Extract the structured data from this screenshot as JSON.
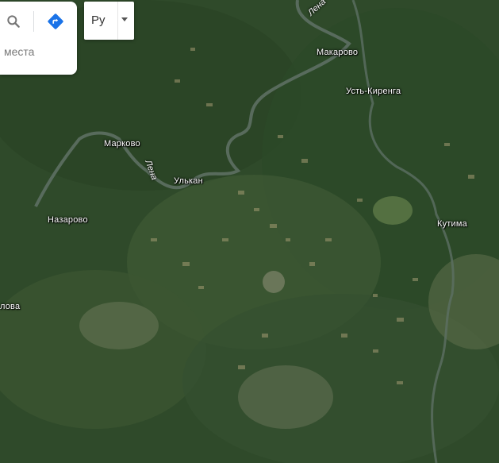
{
  "search_panel": {
    "text": "места",
    "search_icon": "search-icon",
    "directions_icon": "directions-icon"
  },
  "language_select": {
    "value": "Ру",
    "icon": "caret-down-icon"
  },
  "places": [
    {
      "name": "Макарово"
    },
    {
      "name": "Усть-Киренга"
    },
    {
      "name": "Марково"
    },
    {
      "name": "Улькан"
    },
    {
      "name": "Назарово"
    },
    {
      "name": "Кутима"
    },
    {
      "name": "лова"
    }
  ],
  "rivers": [
    {
      "name": "Лена"
    },
    {
      "name": "Лена"
    }
  ],
  "colors": {
    "terrain": "#2f4a2a",
    "river": "#5d6f63",
    "accent": "#1a73e8"
  }
}
